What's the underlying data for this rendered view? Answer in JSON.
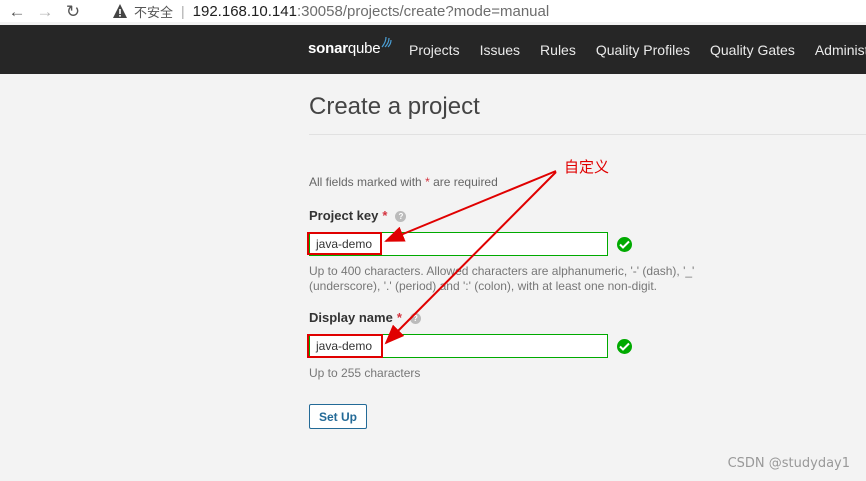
{
  "browser": {
    "insecure_label": "不安全",
    "url_host": "192.168.10.141",
    "url_path": ":30058/projects/create?mode=manual"
  },
  "nav": {
    "logo_bold": "sonar",
    "logo_light": "qube",
    "items": [
      "Projects",
      "Issues",
      "Rules",
      "Quality Profiles",
      "Quality Gates",
      "Administration"
    ]
  },
  "page": {
    "title": "Create a project",
    "required_note_prefix": "All fields marked with",
    "required_star": "*",
    "required_note_suffix": "are required"
  },
  "form": {
    "project_key": {
      "label": "Project key",
      "value": "java-demo",
      "hint_line1": "Up to 400 characters. Allowed characters are alphanumeric, '-' (dash), '_'",
      "hint_line2": "(underscore), '.' (period) and ':' (colon), with at least one non-digit."
    },
    "display_name": {
      "label": "Display name",
      "value": "java-demo",
      "hint": "Up to 255 characters"
    },
    "submit_label": "Set Up"
  },
  "annotation": {
    "text": "自定义"
  },
  "watermark": "CSDN @studyday1",
  "colors": {
    "nav_bg": "#262626",
    "valid_green": "#00aa00",
    "annotation_red": "#e00000",
    "button_blue": "#236a97"
  }
}
